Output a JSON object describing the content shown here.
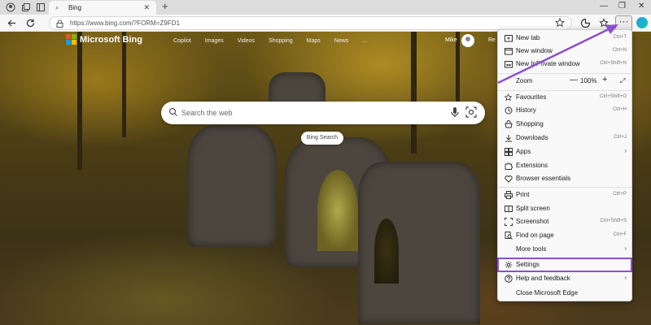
{
  "browser": {
    "tab": {
      "title": "Bing"
    },
    "url": "https://www.bing.com/?FORM=Z9FD1"
  },
  "bing": {
    "brand": "Microsoft Bing",
    "nav": [
      "Copilot",
      "Images",
      "Videos",
      "Shopping",
      "Maps",
      "News",
      "..."
    ],
    "user": "Mike",
    "rewards": "Re",
    "search_placeholder": "Search the web",
    "search_button": "Bing Search"
  },
  "menu": {
    "new_tab": {
      "label": "New tab",
      "shortcut": "Ctrl+T"
    },
    "new_window": {
      "label": "New window",
      "shortcut": "Ctrl+N"
    },
    "new_inprivate": {
      "label": "New InPrivate window",
      "shortcut": "Ctrl+Shift+N"
    },
    "zoom": {
      "label": "Zoom",
      "minus": "—",
      "value": "100%",
      "plus": "+",
      "fullscreen": "⤢"
    },
    "favourites": {
      "label": "Favourites",
      "shortcut": "Ctrl+Shift+O"
    },
    "history": {
      "label": "History",
      "shortcut": "Ctrl+H"
    },
    "shopping": {
      "label": "Shopping"
    },
    "downloads": {
      "label": "Downloads",
      "shortcut": "Ctrl+J"
    },
    "apps": {
      "label": "Apps"
    },
    "extensions": {
      "label": "Extensions"
    },
    "browser_essentials": {
      "label": "Browser essentials"
    },
    "print": {
      "label": "Print",
      "shortcut": "Ctrl+P"
    },
    "split_screen": {
      "label": "Split screen"
    },
    "screenshot": {
      "label": "Screenshot",
      "shortcut": "Ctrl+Shift+S"
    },
    "find_on_page": {
      "label": "Find on page",
      "shortcut": "Ctrl+F"
    },
    "more_tools": {
      "label": "More tools"
    },
    "settings": {
      "label": "Settings"
    },
    "help_feedback": {
      "label": "Help and feedback"
    },
    "close_edge": {
      "label": "Close Microsoft Edge"
    },
    "submenu_arrow": "›"
  },
  "colors": {
    "highlight": "#8a4fcf",
    "bing_logo": [
      "#f25022",
      "#7fba00",
      "#00a4ef",
      "#ffb900"
    ]
  }
}
